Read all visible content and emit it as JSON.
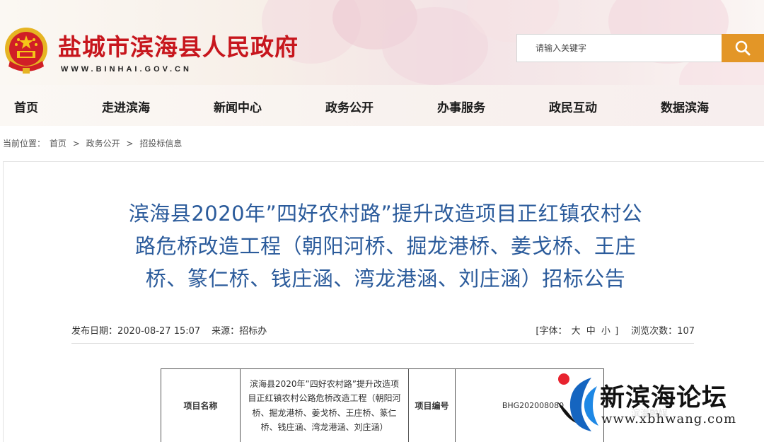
{
  "header": {
    "site_title": "盐城市滨海县人民政府",
    "site_url": "WWW.BINHAI.GOV.CN",
    "search_placeholder": "请输入关键字",
    "emblem_icon": "national-emblem-icon",
    "search_icon": "search-icon",
    "accent_color": "#e39627",
    "title_color": "#c7161d"
  },
  "nav": {
    "items": [
      "首页",
      "走进滨海",
      "新闻中心",
      "政务公开",
      "办事服务",
      "政民互动",
      "数据滨海"
    ]
  },
  "breadcrumb": {
    "label": "当前位置：",
    "items": [
      "首页",
      "政务公开",
      "招投标信息"
    ],
    "separator": ">"
  },
  "article": {
    "title_lines": [
      "滨海县2020年”四好农村路”提升改造项目正红镇农村公",
      "路危桥改造工程（朝阳河桥、掘龙港桥、姜戈桥、王庄",
      "桥、篆仁桥、钱庄涵、湾龙港涵、刘庄涵）招标公告"
    ],
    "title_color": "#2b5b9b",
    "publish_label": "发布日期：",
    "publish_date": "2020-08-27 15:07",
    "source_label": "来源：",
    "source": "招标办",
    "font_label": "[字体：",
    "font_large": "大",
    "font_medium": "中",
    "font_small": "小",
    "font_close": "]",
    "views_label": "浏览次数：",
    "views": "107"
  },
  "info_table": {
    "project_name_label": "项目名称",
    "project_name_lines": [
      "滨海县2020年”四好农村路”提升改造项",
      "目正红镇农村公路危桥改造工程（朝阳河",
      "桥、掘龙港桥、姜戈桥、王庄桥、篆仁",
      "桥、钱庄涵、湾龙港涵、刘庄涵）"
    ],
    "project_no_label": "项目编号",
    "project_no": "BHG202008080"
  },
  "watermark": {
    "logo_icon": "xbhwang-logo-icon",
    "name": "新滨海论坛",
    "url": "www.xbhwang.com",
    "ghost": "滨海融媒"
  }
}
